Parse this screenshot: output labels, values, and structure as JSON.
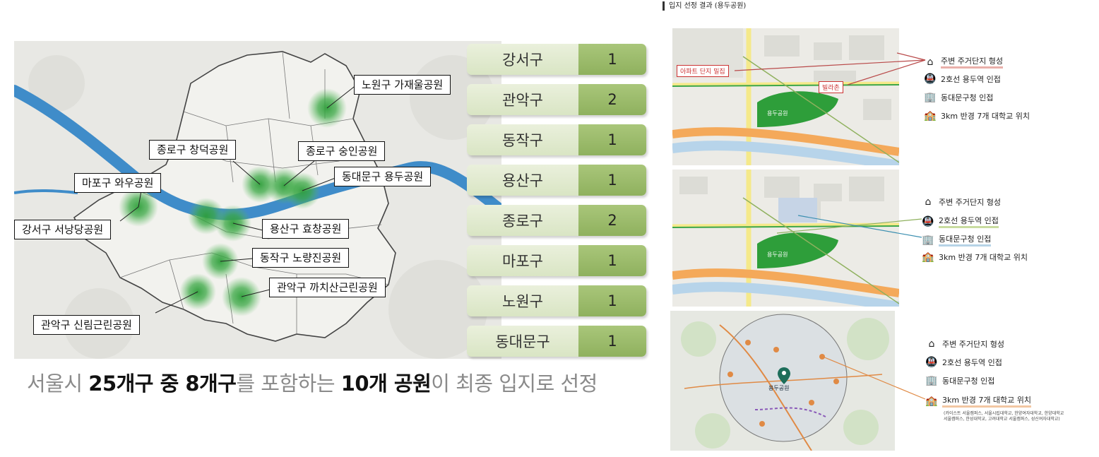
{
  "map": {
    "parks": [
      {
        "label": "노원구 가재울공원"
      },
      {
        "label": "종로구 창덕공원"
      },
      {
        "label": "종로구 숭인공원"
      },
      {
        "label": "동대문구 용두공원"
      },
      {
        "label": "마포구 와우공원"
      },
      {
        "label": "강서구 서낭당공원"
      },
      {
        "label": "용산구 효창공원"
      },
      {
        "label": "동작구 노량진공원"
      },
      {
        "label": "관악구 까치산근린공원"
      },
      {
        "label": "관악구 신림근린공원"
      }
    ]
  },
  "districts": [
    {
      "name": "강서구",
      "count": "1"
    },
    {
      "name": "관악구",
      "count": "2"
    },
    {
      "name": "동작구",
      "count": "1"
    },
    {
      "name": "용산구",
      "count": "1"
    },
    {
      "name": "종로구",
      "count": "2"
    },
    {
      "name": "마포구",
      "count": "1"
    },
    {
      "name": "노원구",
      "count": "1"
    },
    {
      "name": "동대문구",
      "count": "1"
    }
  ],
  "summary": {
    "p1": "서울시 ",
    "b1": "25개구 중 8개구",
    "p2": "를 포함하는 ",
    "b2": "10개 공원",
    "p3": "이 최종 입지로 선정"
  },
  "right": {
    "title": "입지 선정 결과 (용두공원)",
    "park_label": "용두공원",
    "tag_apartment": "아파트 단지 밀집",
    "tag_villa": "빌라촌",
    "features": {
      "housing": "주변 주거단지 형성",
      "station": "2호선 용두역 인접",
      "office": "동대문구청 인접",
      "univ": "3km 반경 7개 대학교 위치"
    },
    "univ_note_1": "(카이스트 서울캠퍼스, 서울시립대학교, 한양여자대학교, 한양대학교",
    "univ_note_2": "서울캠퍼스, 한성대학교, 고려대학교 서울캠퍼스, 성신여자대학교)"
  },
  "colors": {
    "park_green": "#2e9e3a",
    "river_blue": "#3f8cc9",
    "table_light": "#dfe8cc",
    "table_dark": "#9bbb6a",
    "line_red": "#b94a4a",
    "line_green": "#8fb15e",
    "line_blue": "#3b8fb0",
    "line_orange": "#e08a45"
  }
}
